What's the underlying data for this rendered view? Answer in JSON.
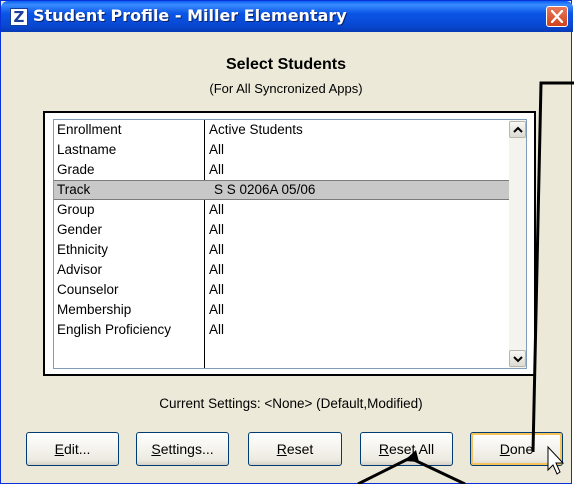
{
  "window": {
    "title": "Student Profile - Miller Elementary",
    "app_icon_glyph": "Z",
    "title_bar_color": "#0848d2",
    "close_button_color": "#d1421c"
  },
  "header": {
    "title": "Select Students",
    "subtitle": "(For All Syncronized Apps)"
  },
  "filters": [
    {
      "field": "Enrollment",
      "value": "Active Students"
    },
    {
      "field": "Lastname",
      "value": "All"
    },
    {
      "field": "Grade",
      "value": "All"
    },
    {
      "field": "Track",
      "value": "S S 0206A 05/06",
      "selected": true
    },
    {
      "field": "Group",
      "value": "All"
    },
    {
      "field": "Gender",
      "value": "All"
    },
    {
      "field": "Ethnicity",
      "value": "All"
    },
    {
      "field": "Advisor",
      "value": "All"
    },
    {
      "field": "Counselor",
      "value": "All"
    },
    {
      "field": "Membership",
      "value": "All"
    },
    {
      "field": "English Proficiency",
      "value": "All"
    }
  ],
  "status_text": "Current Settings: <None> (Default,Modified)",
  "buttons": {
    "edit": {
      "mnemonic": "E",
      "rest": "dit..."
    },
    "settings": {
      "mnemonic": "S",
      "rest": "ettings..."
    },
    "reset": {
      "mnemonic": "R",
      "rest": "eset"
    },
    "reset_all": {
      "mnemonic": "R",
      "rest": "eset All"
    },
    "done": {
      "mnemonic": "D",
      "rest": "one"
    }
  },
  "icons": {
    "close": "close-icon",
    "scroll_up": "chevron-up-icon",
    "scroll_down": "chevron-down-icon",
    "cursor": "mouse-pointer-icon"
  }
}
